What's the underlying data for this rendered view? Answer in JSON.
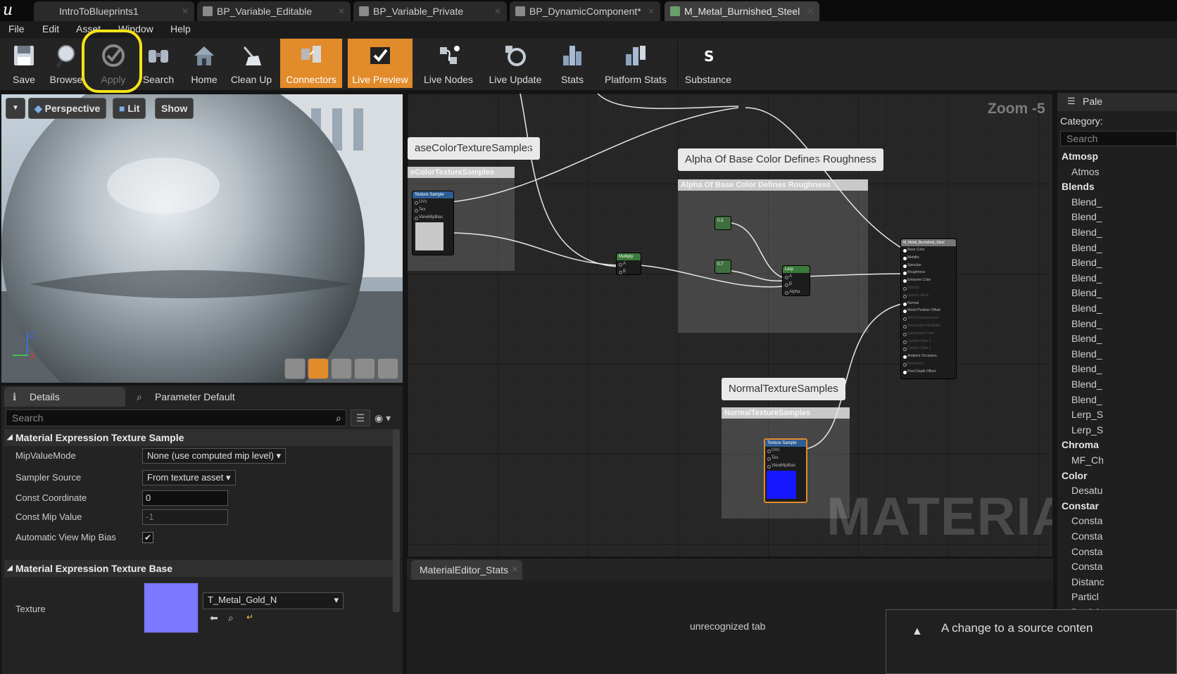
{
  "tabs": [
    "IntroToBlueprints1",
    "BP_Variable_Editable",
    "BP_Variable_Private",
    "BP_DynamicComponent*",
    "M_Metal_Burnished_Steel"
  ],
  "menu": [
    "File",
    "Edit",
    "Asset",
    "Window",
    "Help"
  ],
  "toolbar": {
    "save": "Save",
    "browse": "Browse",
    "apply": "Apply",
    "search": "Search",
    "home": "Home",
    "cleanup": "Clean Up",
    "connectors": "Connectors",
    "live_preview": "Live Preview",
    "live_nodes": "Live Nodes",
    "live_update": "Live Update",
    "stats": "Stats",
    "platform_stats": "Platform Stats",
    "substance": "Substance"
  },
  "viewport": {
    "perspective": "Perspective",
    "lit": "Lit",
    "show": "Show",
    "axis_z": "Z",
    "axis_x": "X"
  },
  "details": {
    "tab_details": "Details",
    "tab_param": "Parameter Default",
    "search_placeholder": "Search",
    "section1": "Material Expression Texture Sample",
    "mip_label": "MipValueMode",
    "mip_value": "None (use computed mip level)",
    "sampler_label": "Sampler Source",
    "sampler_value": "From texture asset",
    "coord_label": "Const Coordinate",
    "coord_value": "0",
    "mipval_label": "Const Mip Value",
    "mipval_value": "-1",
    "automip_label": "Automatic View Mip Bias",
    "automip_checked": true,
    "section2": "Material Expression Texture Base",
    "texture_label": "Texture",
    "texture_value": "T_Metal_Gold_N"
  },
  "graph": {
    "zoom": "Zoom -5",
    "watermark": "MATERIAL",
    "comment1_bubble": "aseColorTextureSamples",
    "comment1_title": "eColorTextureSamples",
    "comment2_bubble": "Alpha Of Base Color Defines Roughness",
    "comment2_title": "Alpha Of Base Color Defines Roughness",
    "comment3_bubble": "NormalTextureSamples",
    "comment3_title": "NormalTextureSamples",
    "tex_node": "Texture Sample",
    "tex_pins": [
      "UVs",
      "Tex",
      "ViewMipBias"
    ],
    "multiply": "Multiply",
    "lerp": "Lerp",
    "pin_a": "A",
    "pin_b": "B",
    "pin_alpha": "Alpha",
    "const1": "0.3",
    "const2": "0.7",
    "result_title": "M_Metal_Burnished_Steel",
    "result_pins": [
      "Base Color",
      "Metallic",
      "Specular",
      "Roughness",
      "Emissive Color",
      "Opacity",
      "Opacity Mask",
      "Normal",
      "World Position Offset",
      "World Displacement",
      "Tessellation Multiplier",
      "Subsurface Color",
      "Custom Data 0",
      "Custom Data 1",
      "Ambient Occlusion",
      "Refraction",
      "Pixel Depth Offset"
    ]
  },
  "stats": {
    "tab": "MaterialEditor_Stats",
    "body": "unrecognized tab"
  },
  "palette": {
    "title": "Pale",
    "category": "Category:",
    "search": "Search",
    "items": [
      {
        "t": "cat",
        "v": "Atmosp"
      },
      {
        "t": "item",
        "v": "Atmos"
      },
      {
        "t": "cat",
        "v": "Blends"
      },
      {
        "t": "item",
        "v": "Blend_"
      },
      {
        "t": "item",
        "v": "Blend_"
      },
      {
        "t": "item",
        "v": "Blend_"
      },
      {
        "t": "item",
        "v": "Blend_"
      },
      {
        "t": "item",
        "v": "Blend_"
      },
      {
        "t": "item",
        "v": "Blend_"
      },
      {
        "t": "item",
        "v": "Blend_"
      },
      {
        "t": "item",
        "v": "Blend_"
      },
      {
        "t": "item",
        "v": "Blend_"
      },
      {
        "t": "item",
        "v": "Blend_"
      },
      {
        "t": "item",
        "v": "Blend_"
      },
      {
        "t": "item",
        "v": "Blend_"
      },
      {
        "t": "item",
        "v": "Blend_"
      },
      {
        "t": "item",
        "v": "Blend_"
      },
      {
        "t": "item",
        "v": "Lerp_S"
      },
      {
        "t": "item",
        "v": "Lerp_S"
      },
      {
        "t": "cat",
        "v": "Chroma"
      },
      {
        "t": "item",
        "v": "MF_Ch"
      },
      {
        "t": "cat",
        "v": "Color"
      },
      {
        "t": "item",
        "v": "Desatu"
      },
      {
        "t": "cat",
        "v": "Constar"
      },
      {
        "t": "item",
        "v": "Consta"
      },
      {
        "t": "item",
        "v": "Consta"
      },
      {
        "t": "item",
        "v": "Consta"
      },
      {
        "t": "item",
        "v": "Consta"
      },
      {
        "t": "item",
        "v": "Distanc"
      },
      {
        "t": "item",
        "v": "Particl"
      },
      {
        "t": "item",
        "v": "Particl"
      }
    ]
  },
  "toast": "A change to a source conten",
  "colors": {
    "accent_orange": "#e28b2b",
    "highlight_yellow": "#f3e21a",
    "normal_preview": "#1717ff",
    "texture_swatch": "#7a79ff"
  }
}
